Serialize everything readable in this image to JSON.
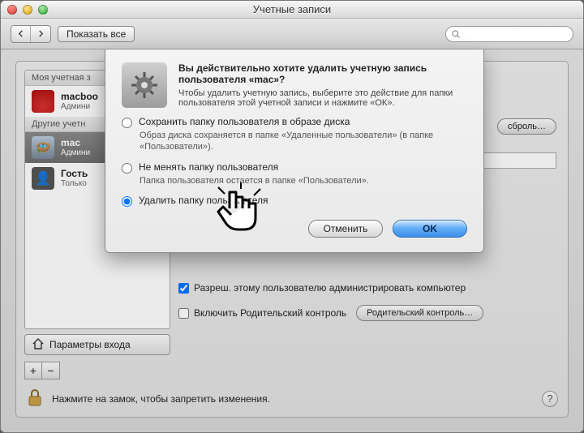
{
  "window": {
    "title": "Учетные записи"
  },
  "toolbar": {
    "show_all": "Показать все",
    "search_placeholder": ""
  },
  "sidebar": {
    "header_mine": "Моя учетная з",
    "header_other": "Другие учетн",
    "login_params": "Параметры входа",
    "add_label": "+",
    "remove_label": "−",
    "accounts": [
      {
        "name": "macboo",
        "sub": "Админи",
        "icon": "red-pot"
      },
      {
        "name": "mac",
        "sub": "Админи",
        "icon": "eggs",
        "selected": true
      },
      {
        "name": "Гость",
        "sub": "Только",
        "icon": "silhouette"
      }
    ]
  },
  "right_panel": {
    "change_password_btn": "сброль…",
    "allow_admin": "Разреш. этому пользователю администрировать компьютер",
    "parental_enable": "Включить Родительский контроль",
    "parental_open": "Родительский контроль…"
  },
  "lock_hint": "Нажмите на замок, чтобы запретить изменения.",
  "sheet": {
    "title": "Вы действительно хотите удалить учетную запись пользователя «mac»?",
    "subtitle": "Чтобы удалить учетную запись, выберите это действие для папки пользователя этой учетной записи и нажмите «ОК».",
    "options": [
      {
        "label": "Сохранить папку пользователя в образе диска",
        "desc": "Образ диска сохраняется в папке «Удаленные пользователи» (в папке «Пользователи»)."
      },
      {
        "label": "Не менять папку пользователя",
        "desc": "Папка пользователя остается в папке «Пользователи»."
      },
      {
        "label": "Удалить папку пользователя",
        "desc": ""
      }
    ],
    "selected_index": 2,
    "cancel": "Отменить",
    "ok": "OK"
  }
}
